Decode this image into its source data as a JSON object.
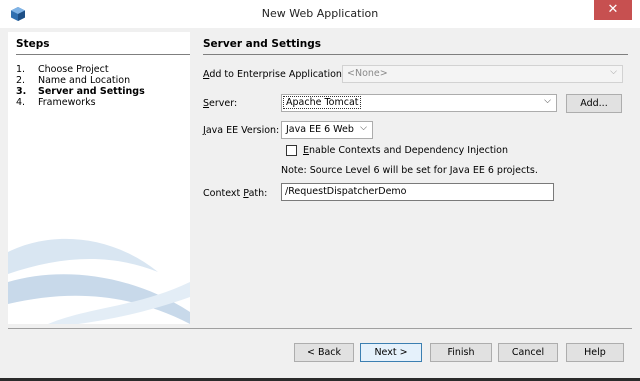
{
  "window": {
    "title": "New Web Application",
    "close_glyph": "✕",
    "icon": "netbeans-cube-icon"
  },
  "steps": {
    "title": "Steps",
    "items": [
      {
        "num": "1.",
        "label": "Choose Project"
      },
      {
        "num": "2.",
        "label": "Name and Location"
      },
      {
        "num": "3.",
        "label": "Server and Settings"
      },
      {
        "num": "4.",
        "label": "Frameworks"
      }
    ],
    "current_index": 2
  },
  "form": {
    "section_title": "Server and Settings",
    "enterprise": {
      "label_mnemonic": "A",
      "label_rest": "dd to Enterprise Application:",
      "value": "<None>"
    },
    "server": {
      "label_mnemonic": "S",
      "label_rest": "erver:",
      "value": "Apache Tomcat",
      "add_button": "Add..."
    },
    "java_ee": {
      "label_mnemonic": "J",
      "label_rest": "ava EE Version:",
      "value": "Java EE 6 Web"
    },
    "cdi": {
      "label_mnemonic": "E",
      "label_rest": "nable Contexts and Dependency Injection",
      "checked": false
    },
    "note": "Note: Source Level 6 will be set for Java EE 6 projects.",
    "context_path": {
      "label_pre": "Context ",
      "label_mnemonic": "P",
      "label_rest": "ath:",
      "value": "/RequestDispatcherDemo"
    }
  },
  "buttons": {
    "back": "< Back",
    "next": "Next >",
    "finish": "Finish",
    "cancel": "Cancel",
    "help": "Help"
  },
  "colors": {
    "close_button": "#c75050",
    "panel_bg": "#f0f0f0",
    "accent": "#3c7fb1"
  }
}
